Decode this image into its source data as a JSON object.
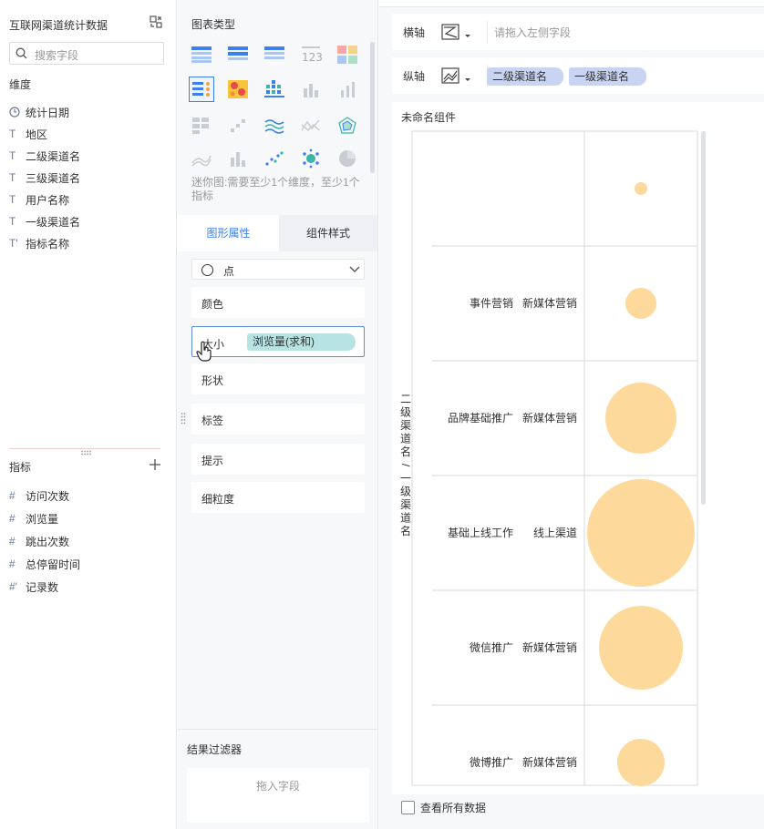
{
  "left": {
    "dataset_title": "互联网渠道统计数据",
    "search_placeholder": "搜索字段",
    "dimension_title": "维度",
    "dimensions": [
      {
        "icon": "clock-icon",
        "label": "统计日期"
      },
      {
        "icon": "text-icon",
        "label": "地区"
      },
      {
        "icon": "text-icon",
        "label": "二级渠道名"
      },
      {
        "icon": "text-icon",
        "label": "三级渠道名"
      },
      {
        "icon": "text-icon",
        "label": "用户名称"
      },
      {
        "icon": "text-icon",
        "label": "一级渠道名"
      },
      {
        "icon": "text-calc-icon",
        "label": "指标名称"
      }
    ],
    "measure_title": "指标",
    "measures": [
      {
        "icon": "hash-icon",
        "label": "访问次数"
      },
      {
        "icon": "hash-icon",
        "label": "浏览量"
      },
      {
        "icon": "hash-icon",
        "label": "跳出次数"
      },
      {
        "icon": "hash-icon",
        "label": "总停留时间"
      },
      {
        "icon": "hash-calc-icon",
        "label": "记录数"
      }
    ]
  },
  "middle": {
    "chart_type_title": "图表类型",
    "hint": "迷你图:需要至少1个维度，至少1个指标",
    "tabs": {
      "active": "图形属性",
      "inactive": "组件样式"
    },
    "mark_type": "点",
    "props": {
      "color": "颜色",
      "size": "大小",
      "size_field": "浏览量(求和)",
      "shape": "形状",
      "label": "标签",
      "tooltip": "提示",
      "granularity": "细粒度"
    },
    "filter_title": "结果过滤器",
    "filter_placeholder": "拖入字段"
  },
  "right": {
    "x_axis_label": "横轴",
    "x_axis_placeholder": "请拖入左侧字段",
    "y_axis_label": "纵轴",
    "y_pills": [
      "二级渠道名",
      "一级渠道名"
    ],
    "component_title": "未命名组件",
    "view_all": "查看所有数据",
    "colors": {
      "accent": "#3d7ff0",
      "bubble": "#fdd99b"
    }
  },
  "chart_data": {
    "type": "scatter",
    "y_axis_title": "二级渠道名/一级渠道名",
    "rows": [
      {
        "level1": "",
        "level2": "",
        "size_rank": 1
      },
      {
        "level1": "事件营销",
        "level2": "新媒体营销",
        "size_rank": 2
      },
      {
        "level1": "品牌基础推广",
        "level2": "新媒体营销",
        "size_rank": 4
      },
      {
        "level1": "基础上线工作",
        "level2": "线上渠道",
        "size_rank": 6
      },
      {
        "level1": "微信推广",
        "level2": "新媒体营销",
        "size_rank": 5
      },
      {
        "level1": "微博推广",
        "level2": "新媒体营销",
        "size_rank": 3
      }
    ]
  }
}
